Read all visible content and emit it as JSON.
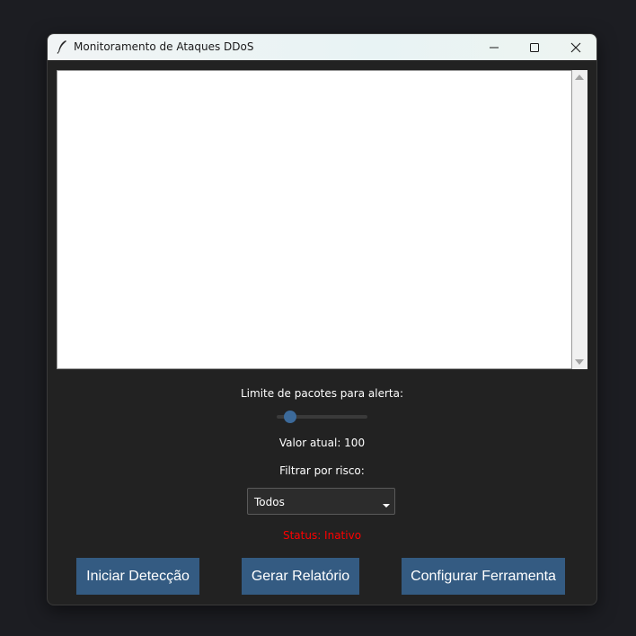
{
  "window": {
    "title": "Monitoramento de Ataques DDoS",
    "icon": "feather-icon",
    "controls": [
      "minimize-icon",
      "maximize-icon",
      "close-icon"
    ]
  },
  "log_area": {
    "content": ""
  },
  "threshold": {
    "label": "Limite de pacotes para alerta:",
    "value": 100,
    "min": 0,
    "max": 657,
    "current_value_text": "Valor atual: 100"
  },
  "filter": {
    "label": "Filtrar por risco:",
    "selected": "Todos"
  },
  "status": {
    "text": "Status: Inativo",
    "color": "#ff0000"
  },
  "buttons": {
    "start_label": "Iniciar Detecção",
    "report_label": "Gerar Relatório",
    "config_label": "Configurar Ferramenta"
  },
  "colors": {
    "button_bg": "#345b82",
    "window_bg": "#222222",
    "slider_handle": "#3c6a9a"
  }
}
